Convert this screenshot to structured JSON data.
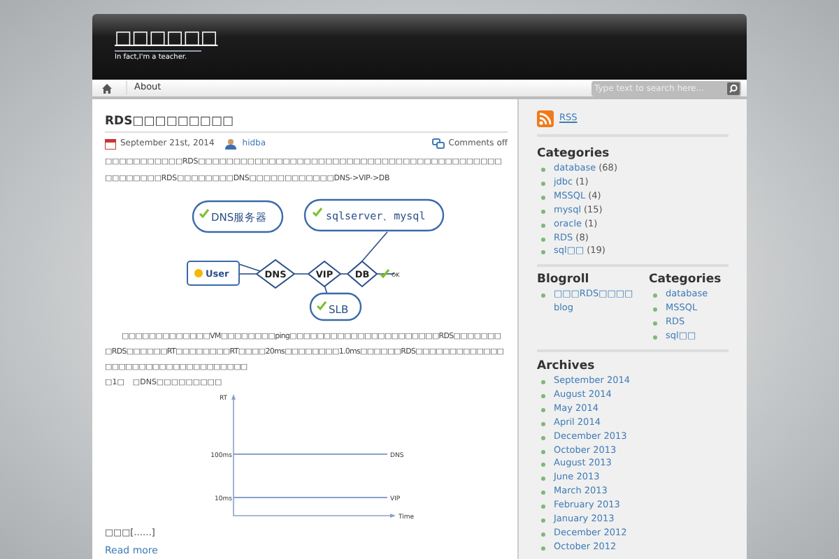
{
  "header": {
    "site_title": "□□□□□□",
    "tagline": "In fact,I'm a teacher."
  },
  "nav": {
    "links": [
      "About"
    ],
    "search_placeholder": "Type text to search here..."
  },
  "post": {
    "title": "RDS□□□□□□□□□",
    "date": "September 21st, 2014",
    "author": "hidba",
    "comments": "Comments off",
    "paragraph_1": "□□□□□□□□□□□RDS□□□□□□□□□□□□□□□□□□□□□□□□□□□□□□□□□□□□□□□□□□□□□□□□□□□RDS□□□□□□□□DNS□□□□□□□□□□□□DNS->VIP->DB",
    "diagram": {
      "dns_server": "DNS服务器",
      "database": "sqlserver、mysql",
      "user": "User",
      "dns": "DNS",
      "vip": "VIP",
      "db": "DB",
      "ok": "OK",
      "slb": "SLB"
    },
    "paragraph_2": "□□□□□□□□□□□□□VM□□□□□□□□ping□□□□□□□□□□□□□□□□□□□□□□RDS□□□□□□□□RDS□□□□□□RT□□□□□□□□RT□□□□20ms□□□□□□□□1.0ms□□□□□□RDS□□□□□□□□□□□□□□□□□□□□□□□□□□□□□□□□□□",
    "paragraph_3": "□1□　□DNS□□□□□□□□□",
    "rt_figure": {
      "y_label": "RT",
      "upper_tick": "100ms",
      "lower_tick": "10ms",
      "upper_line": "DNS",
      "lower_line": "VIP",
      "x_label": "Time"
    },
    "excerpt_end": "□□□[……]",
    "read_more": "Read more"
  },
  "sidebar": {
    "rss": "RSS",
    "categories": {
      "title": "Categories",
      "items": [
        {
          "name": "database",
          "count": "(68)"
        },
        {
          "name": "jdbc",
          "count": "(1)"
        },
        {
          "name": "MSSQL",
          "count": "(4)"
        },
        {
          "name": "mysql",
          "count": "(15)"
        },
        {
          "name": "oracle",
          "count": "(1)"
        },
        {
          "name": "RDS",
          "count": "(8)"
        },
        {
          "name": "sql□□",
          "count": "(19)"
        }
      ]
    },
    "blogroll": {
      "title": "Blogroll",
      "items": [
        "□□□RDS□□□□ blog"
      ]
    },
    "categories_2": {
      "title": "Categories",
      "items": [
        "database",
        "MSSQL",
        "RDS",
        "sql□□"
      ]
    },
    "archives": {
      "title": "Archives",
      "items": [
        "September 2014",
        "August 2014",
        "May 2014",
        "April 2014",
        "December 2013",
        "October 2013",
        "August 2013",
        "June 2013",
        "March 2013",
        "February 2013",
        "January 2013",
        "December 2012",
        "October 2012"
      ]
    }
  }
}
